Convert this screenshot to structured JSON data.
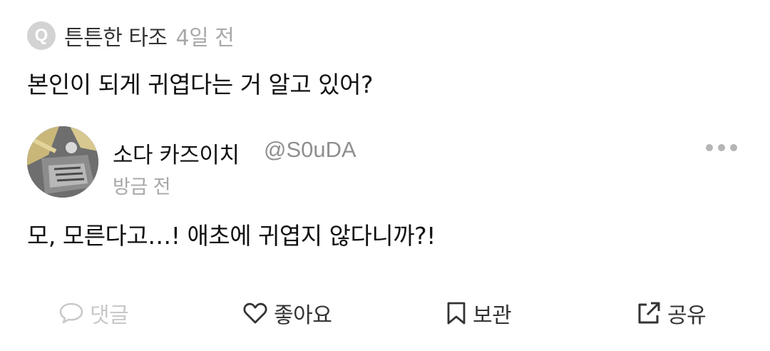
{
  "question": {
    "badge_letter": "Q",
    "author": "튼튼한 타조",
    "time": "4일 전",
    "text": "본인이 되게 귀엽다는 거 알고 있어?"
  },
  "answer": {
    "avatar_icon": "profile-avatar",
    "name": "소다 카즈이치",
    "handle": "@S0uDA",
    "time": "방금 전",
    "more_icon": "more-horizontal-icon",
    "text": "모, 모른다고…! 애초에 귀엽지 않다니까?!"
  },
  "actions": {
    "comment": {
      "icon": "speech-bubble-icon",
      "label": "댓글",
      "disabled": true,
      "color": "#c9c9c9"
    },
    "like": {
      "icon": "heart-icon",
      "label": "좋아요"
    },
    "save": {
      "icon": "bookmark-icon",
      "label": "보관"
    },
    "share": {
      "icon": "share-external-icon",
      "label": "공유"
    }
  },
  "colors": {
    "text_primary": "#111111",
    "text_secondary": "#a8a8a8",
    "badge_bg": "#d3d3d3"
  }
}
